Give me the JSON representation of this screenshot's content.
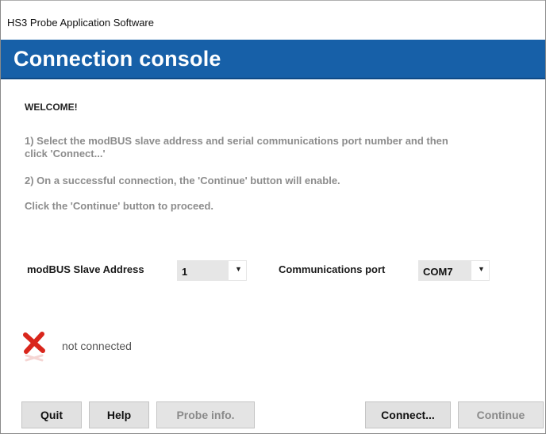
{
  "window": {
    "title": "HS3 Probe Application Software"
  },
  "header": {
    "title": "Connection console"
  },
  "instructions": {
    "welcome": "WELCOME!",
    "step1": "1) Select the modBUS slave address and serial communications port number and then click 'Connect...'",
    "step2": "2) On a successful connection, the 'Continue' button will enable.",
    "step3": "Click the 'Continue' button to proceed."
  },
  "settings": {
    "address_label": "modBUS Slave Address",
    "address_value": "1",
    "port_label": "Communications port",
    "port_value": "COM7"
  },
  "status": {
    "text": "not connected",
    "icon": "red-x-icon",
    "color": "#d9261c"
  },
  "buttons": {
    "quit": "Quit",
    "help": "Help",
    "probe_info": "Probe info.",
    "connect": "Connect...",
    "continue": "Continue"
  },
  "colors": {
    "banner": "#1760a8",
    "instruction_text": "#8c8c8c"
  }
}
